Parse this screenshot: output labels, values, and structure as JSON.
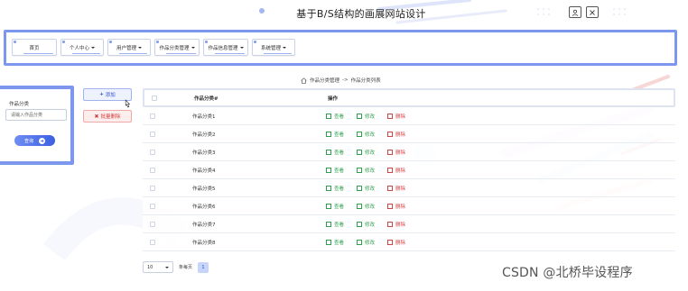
{
  "header": {
    "title": "基于B/S结构的画展网站设计",
    "user_icon": "user-icon",
    "exit_icon": "close-icon"
  },
  "nav": {
    "items": [
      {
        "label": "首页",
        "dropdown": false
      },
      {
        "label": "个人中心",
        "dropdown": true
      },
      {
        "label": "用户管理",
        "dropdown": true
      },
      {
        "label": "作品分类管理",
        "dropdown": true
      },
      {
        "label": "作品信息管理",
        "dropdown": true
      },
      {
        "label": "系统管理",
        "dropdown": true
      }
    ]
  },
  "breadcrumb": {
    "home_icon": "home-icon",
    "section": "作品分类管理",
    "separator": "->",
    "page": "作品分类列表"
  },
  "search": {
    "label": "作品分类",
    "placeholder": "请输入作品分类",
    "query_label": "查询"
  },
  "actions": {
    "add_label": "添加",
    "batch_delete_label": "批量删除"
  },
  "table": {
    "columns": [
      "作品分类#",
      "操作"
    ],
    "rows": [
      "作品分类1",
      "作品分类2",
      "作品分类3",
      "作品分类4",
      "作品分类5",
      "作品分类6",
      "作品分类7",
      "作品分类8"
    ],
    "ops": {
      "view": "查看",
      "edit": "修改",
      "delete": "删除"
    }
  },
  "pager": {
    "page_size": "10",
    "page_size_label": "条每页",
    "current_page": "1"
  },
  "watermark": "CSDN @北桥毕设程序",
  "colors": {
    "accent": "#7d97ef",
    "primary_button": "#3b5fe0",
    "view_green": "#2e9e4f",
    "delete_red": "#d04444"
  }
}
